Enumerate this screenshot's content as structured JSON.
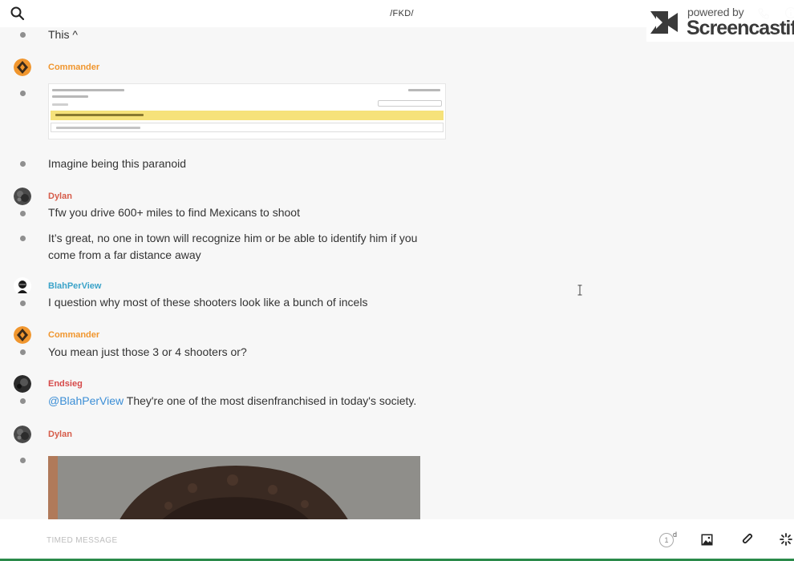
{
  "header": {
    "channel": "/FKD/",
    "search_icon": "search-icon",
    "phone_icon": "phone-icon",
    "info_icon": "info-icon"
  },
  "watermark": {
    "powered": "powered by",
    "brand": "Screencastify"
  },
  "colors": {
    "commander": "#f0962e",
    "dylan": "#d65c4a",
    "blahperview": "#3ba3c9",
    "endsieg": "#d64a4a",
    "mention": "#3b8ed6"
  },
  "feed": {
    "m1_text": "This ^",
    "u1_name": "Commander",
    "m2_text": "Imagine being this paranoid",
    "u2_name": "Dylan",
    "m3_text": "Tfw you drive 600+ miles to find Mexicans to shoot",
    "m4_text": "It’s great, no one in town will recognize him or be able to identify him if you come from a far distance away",
    "u3_name": "BlahPerView",
    "m5_text": "I question why most of these shooters look like a bunch of incels",
    "u4_name": "Commander",
    "m6_text": "You mean just those 3 or 4 shooters or?",
    "u5_name": "Endsieg",
    "m7_mention": "@BlahPerView",
    "m7_text": " They're one of the most disenfranchised in today's society.",
    "u6_name": "Dylan"
  },
  "composer": {
    "placeholder": "TIMED MESSAGE",
    "timer_value": "1",
    "timer_unit": "d"
  }
}
